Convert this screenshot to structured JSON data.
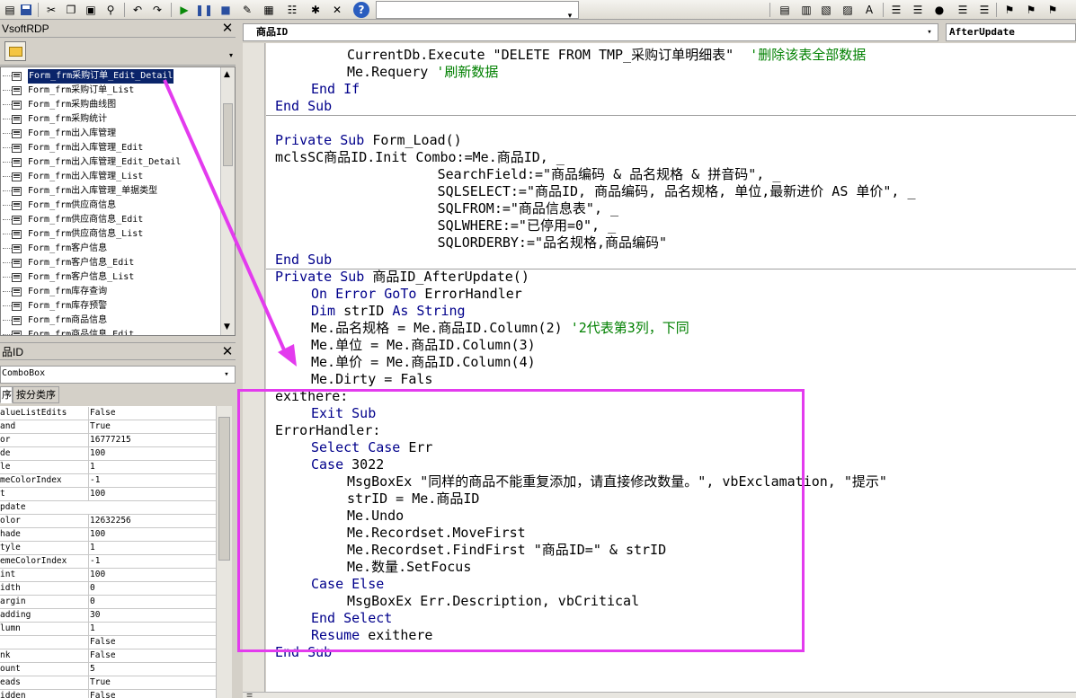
{
  "project_panel": {
    "title": "VsoftRDP",
    "items": [
      {
        "label": "Form_frm采购订单_Edit_Detail",
        "selected": true
      },
      {
        "label": "Form_frm采购订单_List"
      },
      {
        "label": "Form_frm采购曲线图"
      },
      {
        "label": "Form_frm采购统计"
      },
      {
        "label": "Form_frm出入库管理"
      },
      {
        "label": "Form_frm出入库管理_Edit"
      },
      {
        "label": "Form_frm出入库管理_Edit_Detail"
      },
      {
        "label": "Form_frm出入库管理_List"
      },
      {
        "label": "Form_frm出入库管理_单据类型"
      },
      {
        "label": "Form_frm供应商信息"
      },
      {
        "label": "Form_frm供应商信息_Edit"
      },
      {
        "label": "Form_frm供应商信息_List"
      },
      {
        "label": "Form_frm客户信息"
      },
      {
        "label": "Form_frm客户信息_Edit"
      },
      {
        "label": "Form_frm客户信息_List"
      },
      {
        "label": "Form_frm库存查询"
      },
      {
        "label": "Form_frm库存预警"
      },
      {
        "label": "Form_frm商品信息"
      },
      {
        "label": "Form_frm商品信息_Edit"
      }
    ]
  },
  "properties_panel": {
    "title": "品ID",
    "object_type": "ComboBox",
    "tab_alpha": "序",
    "tab_category": "按分类序",
    "rows": [
      {
        "name": "alueListEdits",
        "value": "False"
      },
      {
        "name": "and",
        "value": "True"
      },
      {
        "name": "or",
        "value": "16777215"
      },
      {
        "name": "de",
        "value": "100"
      },
      {
        "name": "le",
        "value": "1"
      },
      {
        "name": "meColorIndex",
        "value": "-1"
      },
      {
        "name": "t",
        "value": "100"
      },
      {
        "name": "pdate",
        "value": ""
      },
      {
        "name": "olor",
        "value": "12632256"
      },
      {
        "name": "hade",
        "value": "100"
      },
      {
        "name": "tyle",
        "value": "1"
      },
      {
        "name": "emeColorIndex",
        "value": "-1"
      },
      {
        "name": "int",
        "value": "100"
      },
      {
        "name": "idth",
        "value": "0"
      },
      {
        "name": "argin",
        "value": "0"
      },
      {
        "name": "adding",
        "value": "30"
      },
      {
        "name": "lumn",
        "value": "1"
      },
      {
        "name": "",
        "value": "False"
      },
      {
        "name": "nk",
        "value": "False"
      },
      {
        "name": "ount",
        "value": "5"
      },
      {
        "name": "eads",
        "value": "True"
      },
      {
        "name": "idden",
        "value": "False"
      }
    ]
  },
  "code_window": {
    "object_dropdown": "商品ID",
    "procedure_dropdown": "AfterUpdate",
    "lines": [
      {
        "indent": 2,
        "parts": [
          {
            "t": "CurrentDb.Execute \"DELETE FROM TMP_采购订单明细表\"  "
          },
          {
            "t": "'删除该表全部数据",
            "c": "cm"
          }
        ]
      },
      {
        "indent": 2,
        "parts": [
          {
            "t": "Me.Requery "
          },
          {
            "t": "'刷新数据",
            "c": "cm"
          }
        ]
      },
      {
        "indent": 1,
        "parts": [
          {
            "t": "End If",
            "c": "kw"
          }
        ]
      },
      {
        "indent": 0,
        "parts": [
          {
            "t": "End Sub",
            "c": "kw"
          }
        ]
      },
      {
        "indent": 0,
        "parts": []
      },
      {
        "indent": 0,
        "parts": [
          {
            "t": "Private Sub",
            "c": "kw"
          },
          {
            "t": " Form_Load()"
          }
        ]
      },
      {
        "indent": 0,
        "parts": [
          {
            "t": "mclsSC商品ID.Init Combo:=Me.商品ID, _"
          }
        ]
      },
      {
        "indent": 0,
        "parts": [
          {
            "t": "                    SearchField:=\"商品编码 & 品名规格 & 拼音码\", _"
          }
        ]
      },
      {
        "indent": 0,
        "parts": [
          {
            "t": "                    SQLSELECT:=\"商品ID, 商品编码, 品名规格, 单位,最新进价 AS 单价\", _"
          }
        ]
      },
      {
        "indent": 0,
        "parts": [
          {
            "t": "                    SQLFROM:=\"商品信息表\", _"
          }
        ]
      },
      {
        "indent": 0,
        "parts": [
          {
            "t": "                    SQLWHERE:=\"已停用=0\", _"
          }
        ]
      },
      {
        "indent": 0,
        "parts": [
          {
            "t": "                    SQLORDERBY:=\"品名规格,商品编码\""
          }
        ]
      },
      {
        "indent": 0,
        "parts": [
          {
            "t": "End Sub",
            "c": "kw"
          }
        ]
      },
      {
        "indent": 0,
        "parts": [
          {
            "t": "Private Sub",
            "c": "kw"
          },
          {
            "t": " 商品ID_AfterUpdate()"
          }
        ]
      },
      {
        "indent": 1,
        "parts": [
          {
            "t": "On Error GoTo",
            "c": "kw"
          },
          {
            "t": " ErrorHandler"
          }
        ]
      },
      {
        "indent": 1,
        "parts": [
          {
            "t": "Dim",
            "c": "kw"
          },
          {
            "t": " strID "
          },
          {
            "t": "As String",
            "c": "kw"
          }
        ]
      },
      {
        "indent": 1,
        "parts": [
          {
            "t": "Me.品名规格 = Me.商品ID.Column(2) "
          },
          {
            "t": "'2代表第3列，下同",
            "c": "cm"
          }
        ]
      },
      {
        "indent": 1,
        "parts": [
          {
            "t": "Me.单位 = Me.商品ID.Column(3)"
          }
        ]
      },
      {
        "indent": 1,
        "parts": [
          {
            "t": "Me.单价 = Me.商品ID.Column(4)"
          }
        ]
      },
      {
        "indent": 1,
        "parts": [
          {
            "t": "Me.Dirty = Fals"
          }
        ]
      },
      {
        "indent": 0,
        "parts": [
          {
            "t": "exithere:"
          }
        ]
      },
      {
        "indent": 1,
        "parts": [
          {
            "t": "Exit Sub",
            "c": "kw"
          }
        ]
      },
      {
        "indent": 0,
        "parts": [
          {
            "t": "ErrorHandler:"
          }
        ]
      },
      {
        "indent": 1,
        "parts": [
          {
            "t": "Select Case",
            "c": "kw"
          },
          {
            "t": " Err"
          }
        ]
      },
      {
        "indent": 1,
        "parts": [
          {
            "t": "Case",
            "c": "kw"
          },
          {
            "t": " 3022"
          }
        ]
      },
      {
        "indent": 2,
        "parts": [
          {
            "t": "MsgBoxEx \"同样的商品不能重复添加，请直接修改数量。\", vbExclamation, \"提示\""
          }
        ]
      },
      {
        "indent": 2,
        "parts": [
          {
            "t": "strID = Me.商品ID"
          }
        ]
      },
      {
        "indent": 2,
        "parts": [
          {
            "t": "Me.Undo"
          }
        ]
      },
      {
        "indent": 2,
        "parts": [
          {
            "t": "Me.Recordset.MoveFirst"
          }
        ]
      },
      {
        "indent": 2,
        "parts": [
          {
            "t": "Me.Recordset.FindFirst \"商品ID=\" & strID"
          }
        ]
      },
      {
        "indent": 2,
        "parts": [
          {
            "t": "Me.数量.SetFocus"
          }
        ]
      },
      {
        "indent": 1,
        "parts": [
          {
            "t": "Case Else",
            "c": "kw"
          }
        ]
      },
      {
        "indent": 2,
        "parts": [
          {
            "t": "MsgBoxEx Err.Description, vbCritical"
          }
        ]
      },
      {
        "indent": 1,
        "parts": [
          {
            "t": "End Select",
            "c": "kw"
          }
        ]
      },
      {
        "indent": 1,
        "parts": [
          {
            "t": "Resume",
            "c": "kw"
          },
          {
            "t": " exithere"
          }
        ]
      },
      {
        "indent": 0,
        "parts": [
          {
            "t": "End Sub",
            "c": "kw"
          }
        ]
      }
    ]
  },
  "colors": {
    "keyword": "#00008b",
    "comment": "#008000",
    "annotation": "#e33bee",
    "selection": "#0a246a"
  }
}
